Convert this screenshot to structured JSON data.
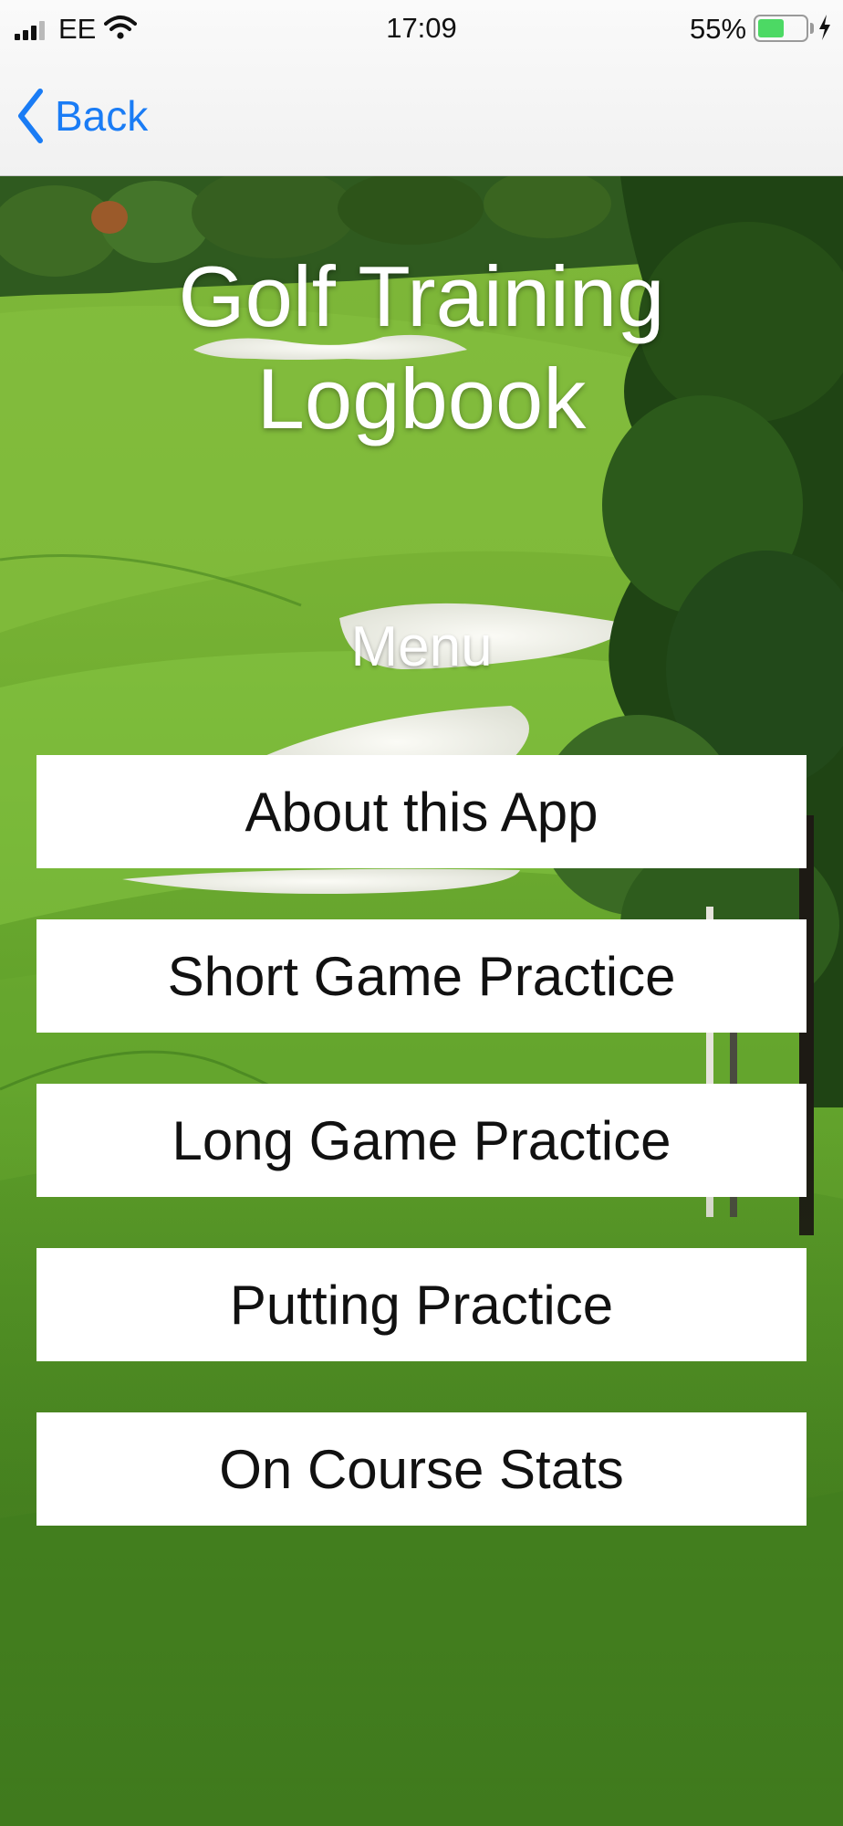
{
  "status_bar": {
    "carrier": "EE",
    "time": "17:09",
    "battery_percent_label": "55%",
    "battery_level": 0.55,
    "signal_bars_filled": 3,
    "signal_bars_total": 4,
    "charging": true
  },
  "nav": {
    "back_label": "Back",
    "accent_color": "#1a7cf5"
  },
  "main": {
    "title": "Golf Training Logbook",
    "menu_heading": "Menu",
    "menu_items": [
      {
        "label": "About this App"
      },
      {
        "label": "Short Game Practice"
      },
      {
        "label": "Long Game Practice"
      },
      {
        "label": "Putting Practice"
      },
      {
        "label": "On Course Stats"
      }
    ]
  },
  "icons": [
    "signal-icon",
    "wifi-icon",
    "battery-icon",
    "charging-bolt-icon",
    "chevron-left-icon"
  ]
}
